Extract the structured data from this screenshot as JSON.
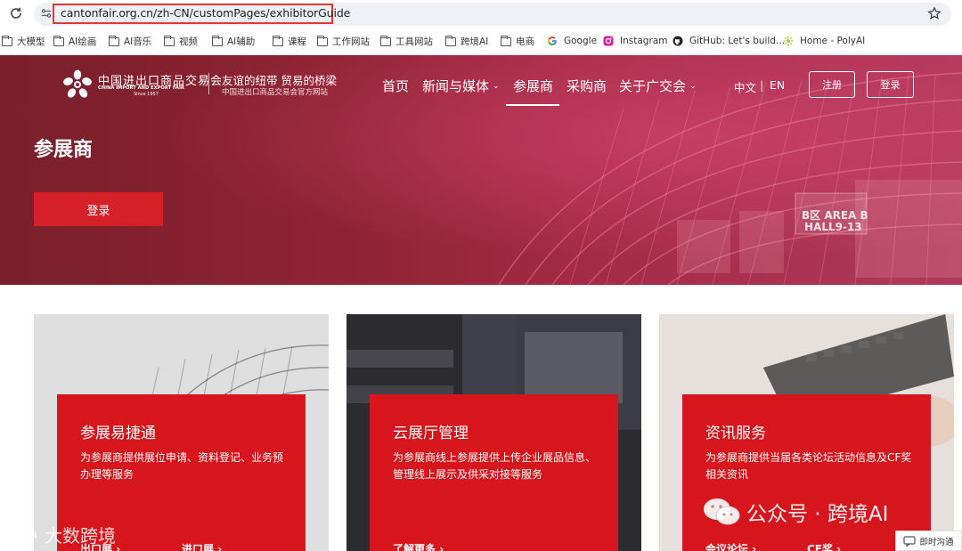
{
  "browser": {
    "url": "cantonfair.org.cn/zh-CN/customPages/exhibitorGuide",
    "bookmarks": [
      {
        "label": "大模型",
        "icon": "folder-icon"
      },
      {
        "label": "AI绘画",
        "icon": "folder-icon"
      },
      {
        "label": "AI音乐",
        "icon": "folder-icon"
      },
      {
        "label": "视频",
        "icon": "folder-icon"
      },
      {
        "label": "AI辅助",
        "icon": "folder-icon"
      },
      {
        "label": "课程",
        "icon": "folder-icon"
      },
      {
        "label": "工作网站",
        "icon": "folder-icon"
      },
      {
        "label": "工具网站",
        "icon": "folder-icon"
      },
      {
        "label": "跨境AI",
        "icon": "folder-icon"
      },
      {
        "label": "电商",
        "icon": "folder-icon"
      },
      {
        "label": "Google",
        "icon": "google-icon"
      },
      {
        "label": "Instagram",
        "icon": "instagram-icon"
      },
      {
        "label": "GitHub: Let's build...",
        "icon": "github-icon"
      },
      {
        "label": "Home - PolyAI",
        "icon": "polyai-icon"
      }
    ],
    "highlight_color": "#e53935"
  },
  "site": {
    "logo": {
      "cn": "中国进出口商品交易会",
      "en": "CHINA IMPORT AND EXPORT FAIR",
      "since": "Since 1957"
    },
    "slogan": "友谊的纽带 贸易的桥梁",
    "slogan_sub": "中国进出口商品交易会官方网站",
    "nav": [
      {
        "label": "首页",
        "dropdown": false
      },
      {
        "label": "新闻与媒体",
        "dropdown": true
      },
      {
        "label": "参展商",
        "dropdown": false,
        "active": true
      },
      {
        "label": "采购商",
        "dropdown": false
      },
      {
        "label": "关于广交会",
        "dropdown": true
      }
    ],
    "lang_cn": "中文",
    "lang_sep": "|",
    "lang_en": "EN",
    "register": "注册",
    "login": "登录"
  },
  "hero": {
    "title": "参展商",
    "login_button": "登录",
    "building_sign_1": "B区 AREA B",
    "building_sign_2": "HALL9-13"
  },
  "cards": [
    {
      "title": "参展易捷通",
      "desc": "为参展商提供展位申请、资料登记、业务预办理等服务",
      "links": [
        "出口展",
        "进口展"
      ]
    },
    {
      "title": "云展厅管理",
      "desc": "为参展商线上参展提供上传企业展品信息、管理线上展示及供采对接等服务",
      "links": [
        "了解更多"
      ]
    },
    {
      "title": "资讯服务",
      "desc": "为参展商提供当届各类论坛活动信息及CF奖相关资讯",
      "links": [
        "会议论坛",
        "CF奖"
      ]
    }
  ],
  "overlays": {
    "watermark_left": "大数跨境",
    "watermark_right": "公众号 · 跨境AI",
    "chat_button": "即时沟通"
  },
  "colors": {
    "brand_red": "#d52027",
    "card_red": "#d6151d",
    "hero_base": "#8e2333"
  }
}
